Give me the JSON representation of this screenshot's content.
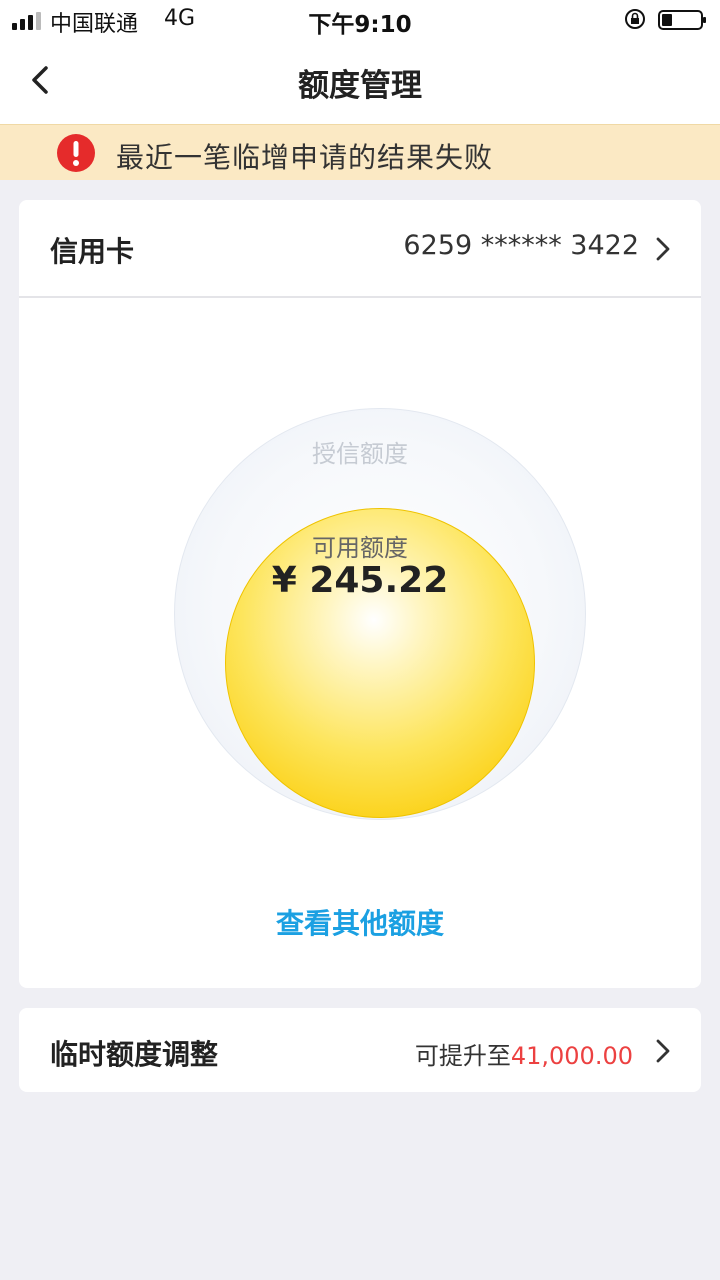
{
  "status_bar": {
    "carrier": "中国联通",
    "network": "4G",
    "time": "下午9:10",
    "icons": [
      "signal-icon",
      "rotation-lock-icon",
      "battery-icon"
    ]
  },
  "nav": {
    "title": "额度管理",
    "back_icon": "chevron-left-icon"
  },
  "alert": {
    "icon": "exclamation-circle-icon",
    "text": "最近一笔临增申请的结果失败",
    "color": "#e52b2b"
  },
  "credit_card": {
    "label": "信用卡",
    "card_number": "6259 ****** 3422"
  },
  "quota": {
    "outer_label": "授信额度",
    "inner_label": "可用额度",
    "available_amount": "¥ 245.22"
  },
  "other_link": "查看其他额度",
  "temp_adjust": {
    "label": "临时额度调整",
    "prefix": "可提升至",
    "amount": "41,000.00",
    "amount_color": "#ec4141"
  },
  "colors": {
    "accent": "#1ba0e2",
    "banner_bg": "#fbe9c4",
    "bubble_yellow": "#fbd21a"
  }
}
